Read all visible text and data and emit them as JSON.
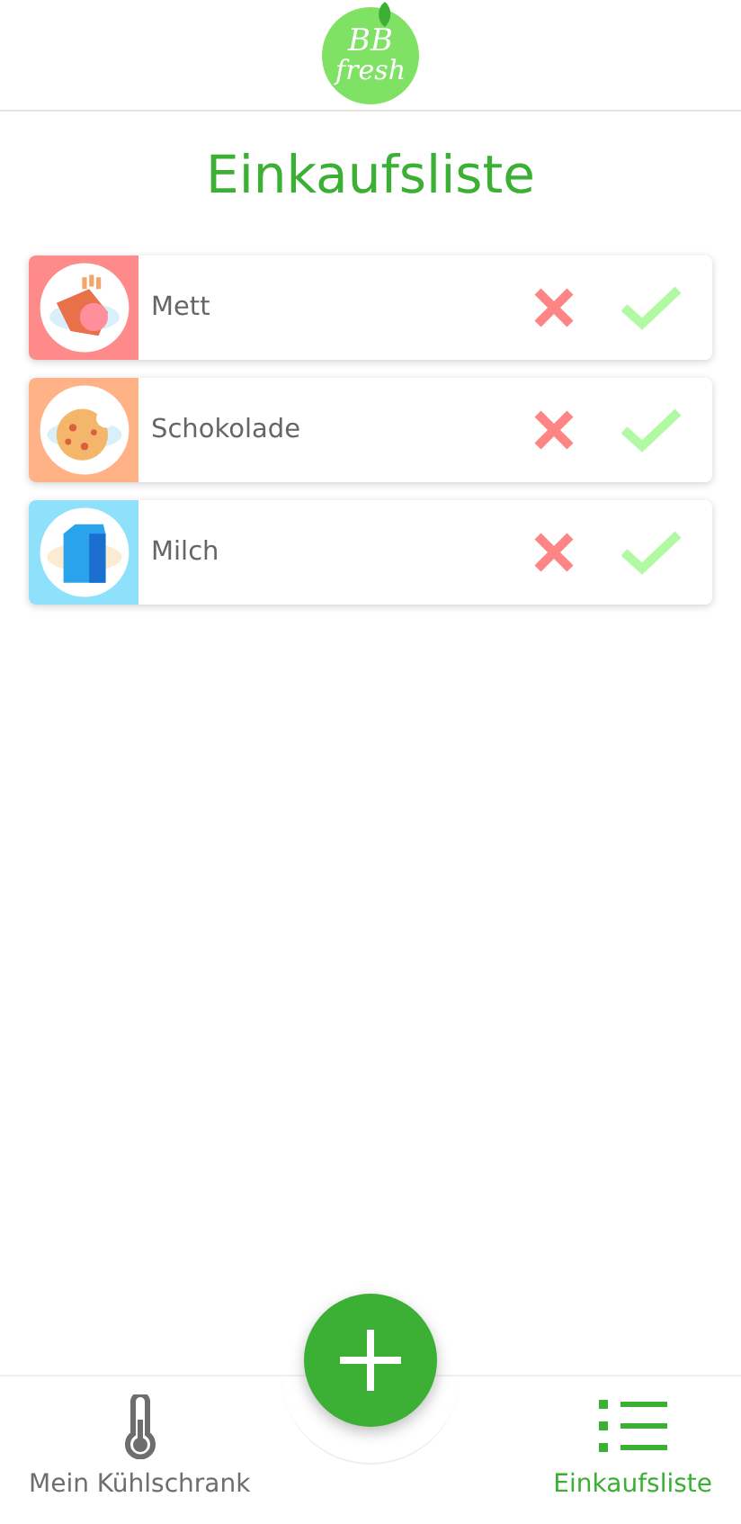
{
  "logo": {
    "line_1": "BB",
    "line_2": "fresh"
  },
  "title": "Einkaufsliste",
  "items": [
    {
      "name": "Mett",
      "kind": "meat",
      "color": "#ff8a8a"
    },
    {
      "name": "Schokolade",
      "kind": "cookie",
      "color": "#ffb285"
    },
    {
      "name": "Milch",
      "kind": "milk",
      "color": "#8ee0fb"
    }
  ],
  "nav": [
    {
      "label": "Mein Kühlschrank",
      "kind": "thermometer",
      "selected": false
    },
    {
      "label": "Einkaufsliste",
      "kind": "list",
      "selected": true
    }
  ]
}
